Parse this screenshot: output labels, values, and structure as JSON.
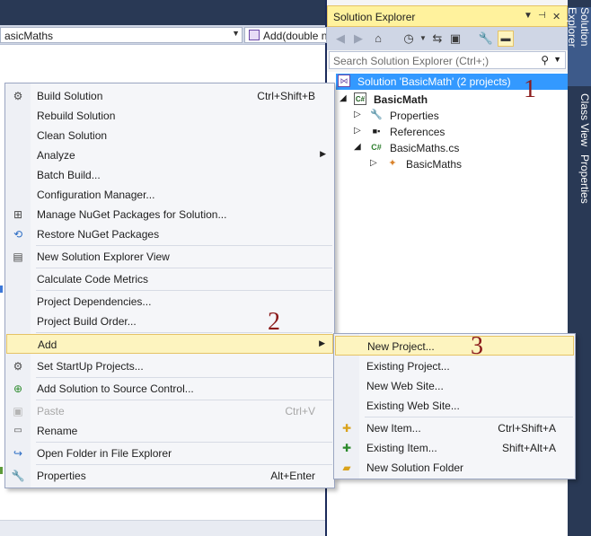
{
  "editor": {
    "left_combo": "asicMaths",
    "right_combo": "Add(double n"
  },
  "context_menu": {
    "items": [
      {
        "label": "Build Solution",
        "shortcut": "Ctrl+Shift+B",
        "icon": "build-icon"
      },
      {
        "label": "Rebuild Solution",
        "shortcut": ""
      },
      {
        "label": "Clean Solution",
        "shortcut": ""
      },
      {
        "label": "Analyze",
        "shortcut": ""
      },
      {
        "label": "Batch Build...",
        "shortcut": ""
      },
      {
        "label": "Configuration Manager...",
        "shortcut": ""
      },
      {
        "label": "Manage NuGet Packages for Solution...",
        "shortcut": "",
        "icon": "nuget-icon"
      },
      {
        "label": "Restore NuGet Packages",
        "shortcut": "",
        "icon": "restore-icon"
      },
      {
        "label": "New Solution Explorer View",
        "shortcut": "",
        "icon": "new-view-icon"
      },
      {
        "label": "Calculate Code Metrics",
        "shortcut": ""
      },
      {
        "label": "Project Dependencies...",
        "shortcut": ""
      },
      {
        "label": "Project Build Order...",
        "shortcut": ""
      },
      {
        "label": "Add",
        "shortcut": ""
      },
      {
        "label": "Set StartUp Projects...",
        "shortcut": "",
        "icon": "gear-icon"
      },
      {
        "label": "Add Solution to Source Control...",
        "shortcut": "",
        "icon": "source-control-icon"
      },
      {
        "label": "Paste",
        "shortcut": "Ctrl+V",
        "icon": "paste-icon",
        "disabled": true
      },
      {
        "label": "Rename",
        "shortcut": "",
        "icon": "rename-icon"
      },
      {
        "label": "Open Folder in File Explorer",
        "shortcut": "",
        "icon": "open-folder-icon"
      },
      {
        "label": "Properties",
        "shortcut": "Alt+Enter",
        "icon": "wrench-icon"
      }
    ]
  },
  "add_submenu": {
    "items": [
      {
        "label": "New Project...",
        "shortcut": ""
      },
      {
        "label": "Existing Project...",
        "shortcut": ""
      },
      {
        "label": "New Web Site...",
        "shortcut": ""
      },
      {
        "label": "Existing Web Site...",
        "shortcut": ""
      },
      {
        "label": "New Item...",
        "shortcut": "Ctrl+Shift+A",
        "icon": "new-item-icon"
      },
      {
        "label": "Existing Item...",
        "shortcut": "Shift+Alt+A",
        "icon": "existing-item-icon"
      },
      {
        "label": "New Solution Folder",
        "shortcut": "",
        "icon": "folder-icon"
      }
    ]
  },
  "solution_explorer": {
    "title": "Solution Explorer",
    "search_placeholder": "Search Solution Explorer (Ctrl+;)",
    "tree": {
      "solution": "Solution 'BasicMath' (2 projects)",
      "project": "BasicMath",
      "properties": "Properties",
      "references": "References",
      "file": "BasicMaths.cs",
      "class": "BasicMaths"
    }
  },
  "side_tabs": [
    "Solution Explorer",
    "Class View",
    "Properties"
  ],
  "steps": [
    "1",
    "2",
    "3"
  ],
  "colors": {
    "selection": "#3399ff",
    "menu_highlight": "#fdf4bf",
    "step_number": "#8b1a1a",
    "chrome_dark": "#293955"
  }
}
